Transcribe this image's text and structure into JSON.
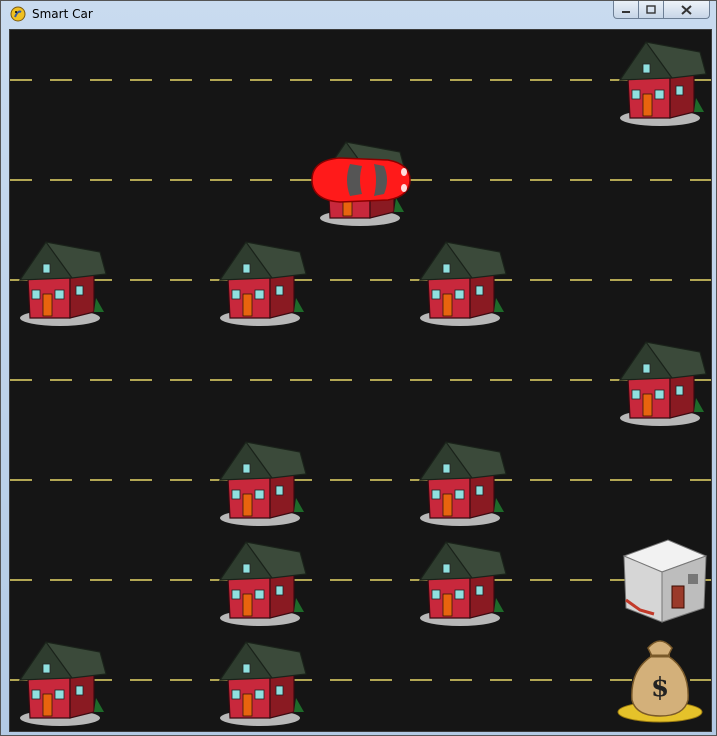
{
  "window": {
    "title": "Smart Car",
    "icon": "python-snake-icon",
    "controls": {
      "minimize": "minimize-icon",
      "maximize": "maximize-icon",
      "close": "close-icon"
    }
  },
  "grid": {
    "rows": 7,
    "cols": 7,
    "houses": [
      [
        0,
        6
      ],
      [
        2,
        0
      ],
      [
        2,
        2
      ],
      [
        2,
        4
      ],
      [
        3,
        6
      ],
      [
        4,
        2
      ],
      [
        4,
        4
      ],
      [
        5,
        2
      ],
      [
        5,
        4
      ],
      [
        6,
        0
      ],
      [
        6,
        2
      ]
    ],
    "car": [
      1,
      3
    ],
    "car_over_house": true,
    "bank": [
      5,
      6
    ],
    "goal": [
      6,
      6
    ]
  },
  "colors": {
    "road": "#151515",
    "lane_marking": "#e8d86a",
    "car": "#ff1a1a",
    "house_wall": "#c8283c",
    "house_roof": "#3b4a3a"
  }
}
